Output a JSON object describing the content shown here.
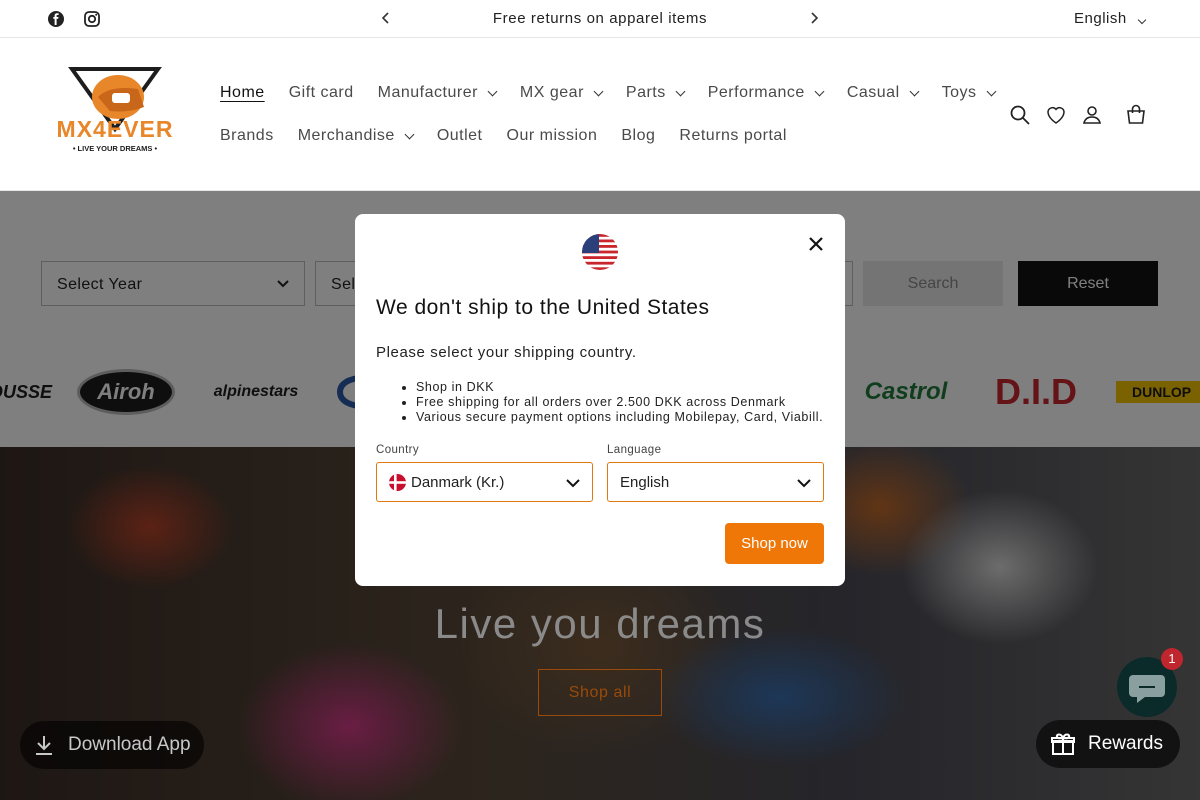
{
  "announcement": {
    "message": "Free returns on apparel items",
    "prev_icon": "chevron-left-icon",
    "next_icon": "chevron-right-icon",
    "language": "English",
    "social": [
      "facebook-icon",
      "instagram-icon"
    ]
  },
  "header": {
    "logo_text": "MX4EVER",
    "logo_tagline": "LIVE YOUR DREAMS",
    "nav_row1": [
      {
        "label": "Home",
        "dropdown": false,
        "active": true
      },
      {
        "label": "Gift card",
        "dropdown": false
      },
      {
        "label": "Manufacturer",
        "dropdown": true
      },
      {
        "label": "MX gear",
        "dropdown": true
      },
      {
        "label": "Parts",
        "dropdown": true
      },
      {
        "label": "Performance",
        "dropdown": true
      },
      {
        "label": "Casual",
        "dropdown": true
      },
      {
        "label": "Toys",
        "dropdown": true
      }
    ],
    "nav_row2": [
      {
        "label": "Brands",
        "dropdown": false
      },
      {
        "label": "Merchandise",
        "dropdown": true
      },
      {
        "label": "Outlet",
        "dropdown": false
      },
      {
        "label": "Our mission",
        "dropdown": false
      },
      {
        "label": "Blog",
        "dropdown": false
      },
      {
        "label": "Returns portal",
        "dropdown": false
      }
    ],
    "icons": [
      "search-icon",
      "heart-icon",
      "account-icon",
      "cart-icon"
    ]
  },
  "filter": {
    "year_label": "Select Year",
    "make_label": "Sel",
    "search_label": "Search",
    "reset_label": "Reset"
  },
  "brands": [
    "DUSSE",
    "Airoh",
    "alpinestars",
    "Castrol",
    "D.I.D",
    "DUNLOP"
  ],
  "hero": {
    "title": "Live you dreams",
    "button": "Shop all"
  },
  "widgets": {
    "download_label": "Download App",
    "chat_badge": "1",
    "rewards_label": "Rewards"
  },
  "modal": {
    "title": "We don't ship to the United States",
    "subtitle": "Please select your shipping country.",
    "bullets": [
      "Shop in DKK",
      "Free shipping for all orders over 2.500 DKK across Denmark",
      "Various secure payment options including Mobilepay, Card, Viabill."
    ],
    "country_label": "Country",
    "country_value": "Danmark (Kr.)",
    "language_label": "Language",
    "language_value": "English",
    "shop_now": "Shop now",
    "accent": "#ee7708"
  }
}
